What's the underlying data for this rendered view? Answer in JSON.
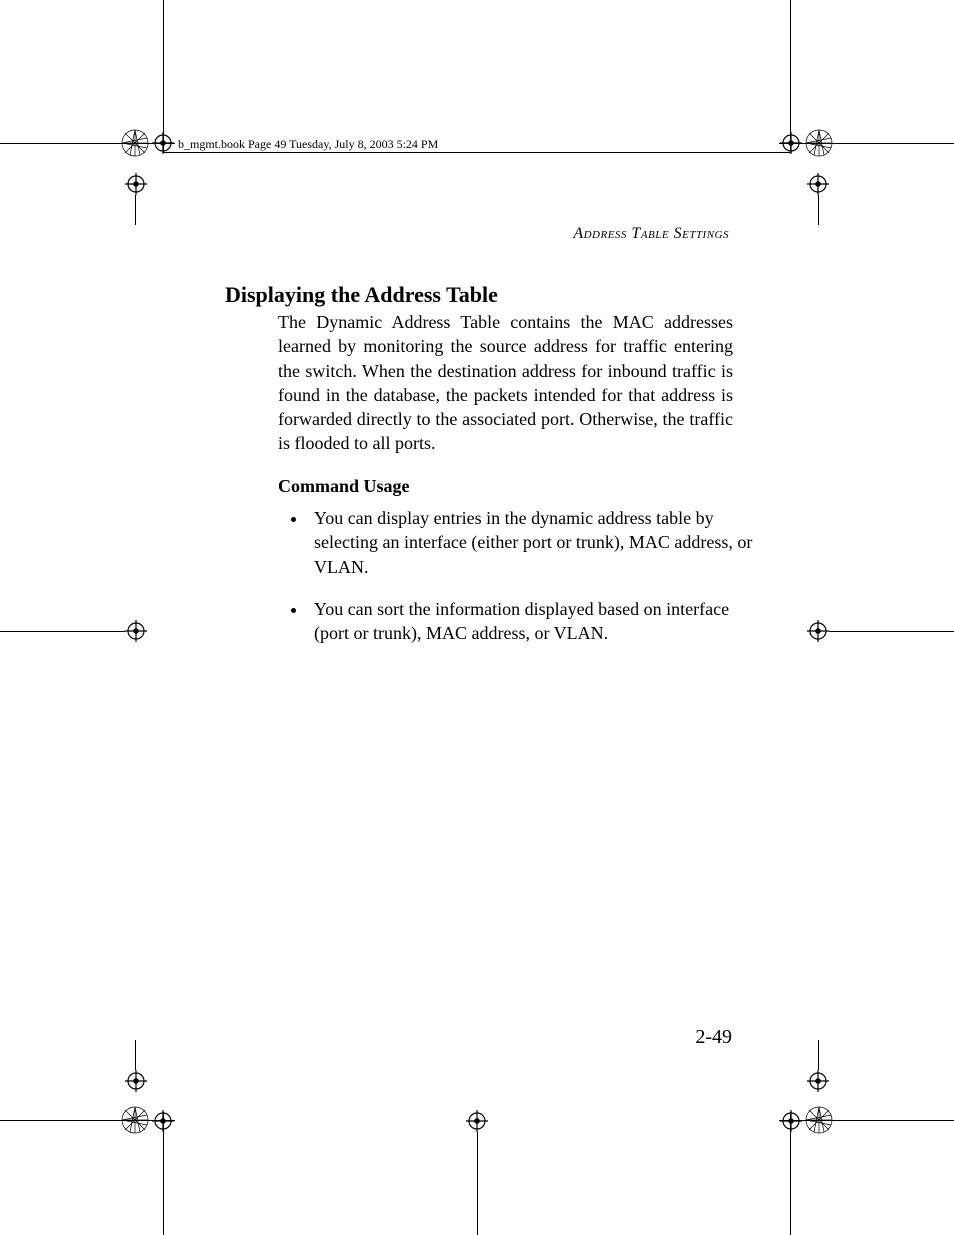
{
  "print_header": "b_mgmt.book  Page 49  Tuesday, July 8, 2003  5:24 PM",
  "running_header": "Address Table Settings",
  "heading": "Displaying the Address Table",
  "intro_paragraph": "The Dynamic Address Table contains the MAC addresses learned by monitoring the source address for traffic entering the switch. When the destination address for inbound traffic is found in the database, the packets intended for that address is forwarded directly to the associated port. Otherwise, the traffic is flooded to all ports.",
  "subhead": "Command Usage",
  "bullets": [
    "You can display entries in the dynamic address table by selecting an interface (either port or trunk), MAC address, or VLAN.",
    "You can sort the information displayed based on interface (port or trunk), MAC address, or VLAN."
  ],
  "page_number": "2-49"
}
